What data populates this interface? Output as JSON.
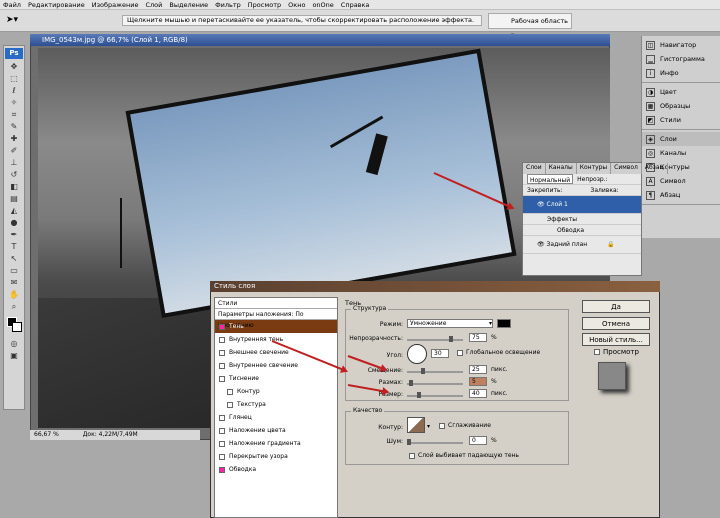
{
  "menu": [
    "Файл",
    "Редактирование",
    "Изображение",
    "Слой",
    "Выделение",
    "Фильтр",
    "Просмотр",
    "Окно",
    "onOne",
    "Справка"
  ],
  "options": {
    "hint": "Щелкните мышью и перетаскивайте ее указатель, чтобы скорректировать расположение эффекта.",
    "workspace": "Рабочая область"
  },
  "document": {
    "title": "IMG_0543м.jpg @ 66,7% (Слой 1, RGB/8)",
    "zoom": "66,67 %",
    "doc_size": "Док: 4,22M/7,49M"
  },
  "dock": {
    "group1": [
      "Навигатор",
      "Гистограмма",
      "Инфо"
    ],
    "group2": [
      "Цвет",
      "Образцы",
      "Стили"
    ],
    "group3": [
      "Слои",
      "Каналы",
      "Контуры",
      "Символ",
      "Абзац"
    ]
  },
  "layers": {
    "tabs": [
      "Слои",
      "Каналы",
      "Контуры",
      "Символ",
      "Абзац"
    ],
    "blend": "Нормальный",
    "opacity_label": "Непрозр.:",
    "lock_label": "Закрепить:",
    "fill_label": "Заливка:",
    "rows": [
      "Слой 1",
      "Эффекты",
      "Обводка",
      "Задний план"
    ]
  },
  "dialog": {
    "title": "Стиль слоя",
    "list_header": "Стили",
    "blend_defaults": "Параметры наложения: По умолчанию",
    "styles": [
      "Тень",
      "Внутренняя тень",
      "Внешнее свечение",
      "Внутреннее свечение",
      "Тиснение",
      "Контур",
      "Текстура",
      "Глянец",
      "Наложение цвета",
      "Наложение градиента",
      "Перекрытие узора",
      "Обводка"
    ],
    "section": "Тень",
    "structure": "Структура",
    "mode_label": "Режим:",
    "mode": "Умножение",
    "opacity_label": "Непрозрачность:",
    "opacity": "75",
    "angle_label": "Угол:",
    "angle": "30",
    "global_light": "Глобальное освещение",
    "distance_label": "Смещение:",
    "distance": "25",
    "spread_label": "Размах:",
    "spread": "5",
    "size_label": "Размер:",
    "size": "40",
    "px": "пикс.",
    "pct": "%",
    "quality": "Качество",
    "contour_label": "Контур:",
    "antialias": "Сглаживание",
    "noise_label": "Шум:",
    "noise": "0",
    "knockout": "Слой выбивает падающую тень",
    "ok": "Да",
    "cancel": "Отмена",
    "new_style": "Новый стиль...",
    "preview": "Просмотр"
  }
}
